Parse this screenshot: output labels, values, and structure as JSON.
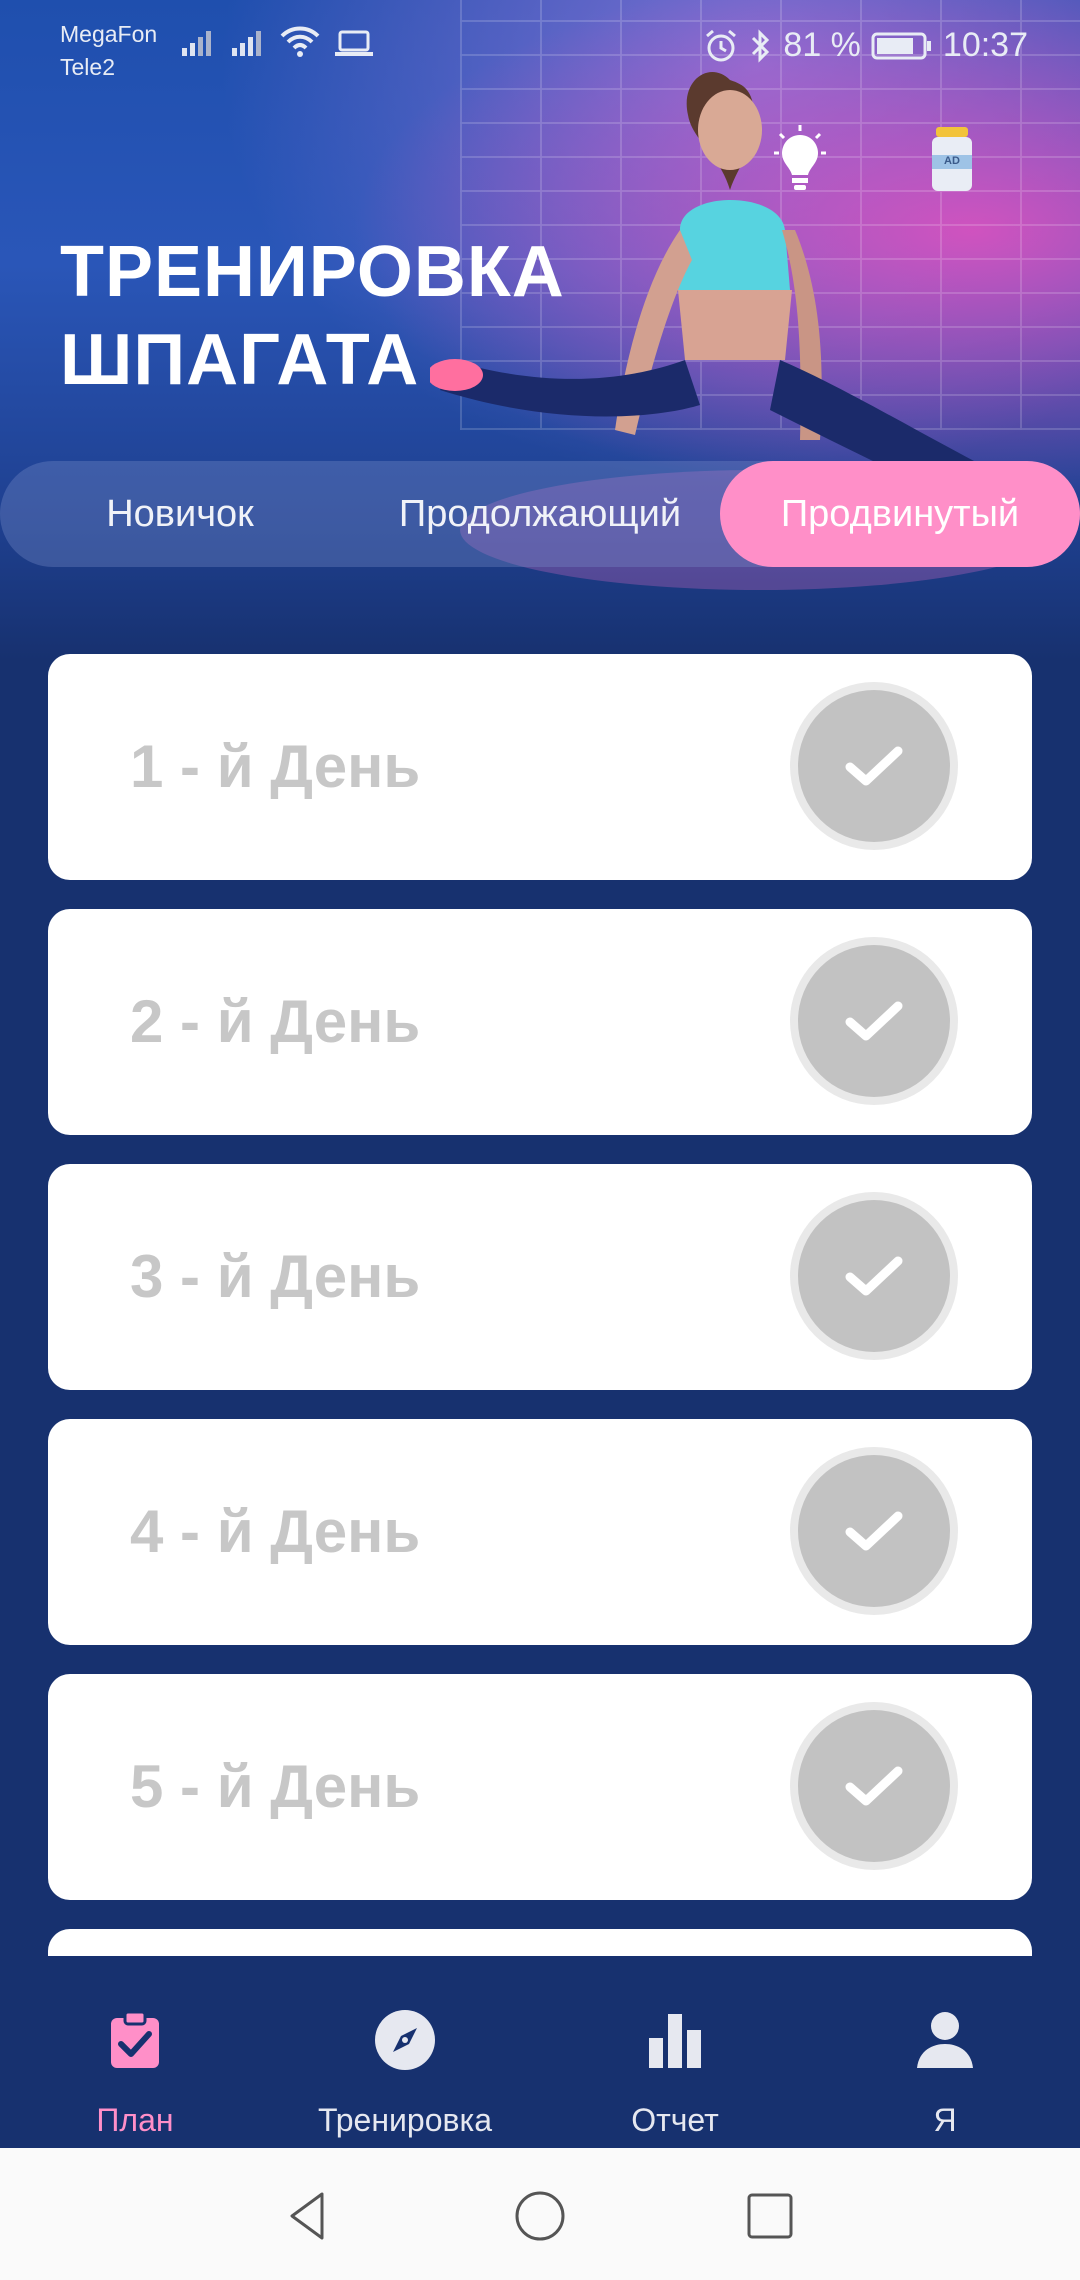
{
  "status_bar": {
    "carrier1": "MegaFon",
    "carrier2": "Tele2",
    "battery_pct": "81 %",
    "time": "10:37",
    "icons": [
      "signal-icon",
      "signal-icon",
      "wifi-icon",
      "laptop-icon",
      "alarm-icon",
      "bluetooth-icon",
      "battery-icon"
    ]
  },
  "header": {
    "title_line1": "ТРЕНИРОВКА",
    "title_line2": "ШПАГАТА",
    "tips_icon": "lightbulb-icon",
    "ad_icon": "ad-jar-icon",
    "ad_text": "AD"
  },
  "levels": {
    "items": [
      "Новичок",
      "Продолжающий",
      "Продвинутый"
    ],
    "selected": "Продвинутый",
    "accent": "#ff8fc8"
  },
  "days": [
    {
      "label": "1 - й День",
      "completed_icon": "check-icon"
    },
    {
      "label": "2 - й День",
      "completed_icon": "check-icon"
    },
    {
      "label": "3 - й День",
      "completed_icon": "check-icon"
    },
    {
      "label": "4 - й День",
      "completed_icon": "check-icon"
    },
    {
      "label": "5 - й День",
      "completed_icon": "check-icon"
    }
  ],
  "bottom_nav": {
    "items": [
      {
        "label": "План",
        "icon": "clipboard-check-icon",
        "active": true
      },
      {
        "label": "Тренировка",
        "icon": "compass-icon",
        "active": false
      },
      {
        "label": "Отчет",
        "icon": "bar-chart-icon",
        "active": false
      },
      {
        "label": "Я",
        "icon": "person-icon",
        "active": false
      }
    ]
  },
  "colors": {
    "background": "#17316f",
    "accent": "#ff8fc8",
    "card": "#ffffff",
    "muted_text": "#c7c7c7"
  }
}
